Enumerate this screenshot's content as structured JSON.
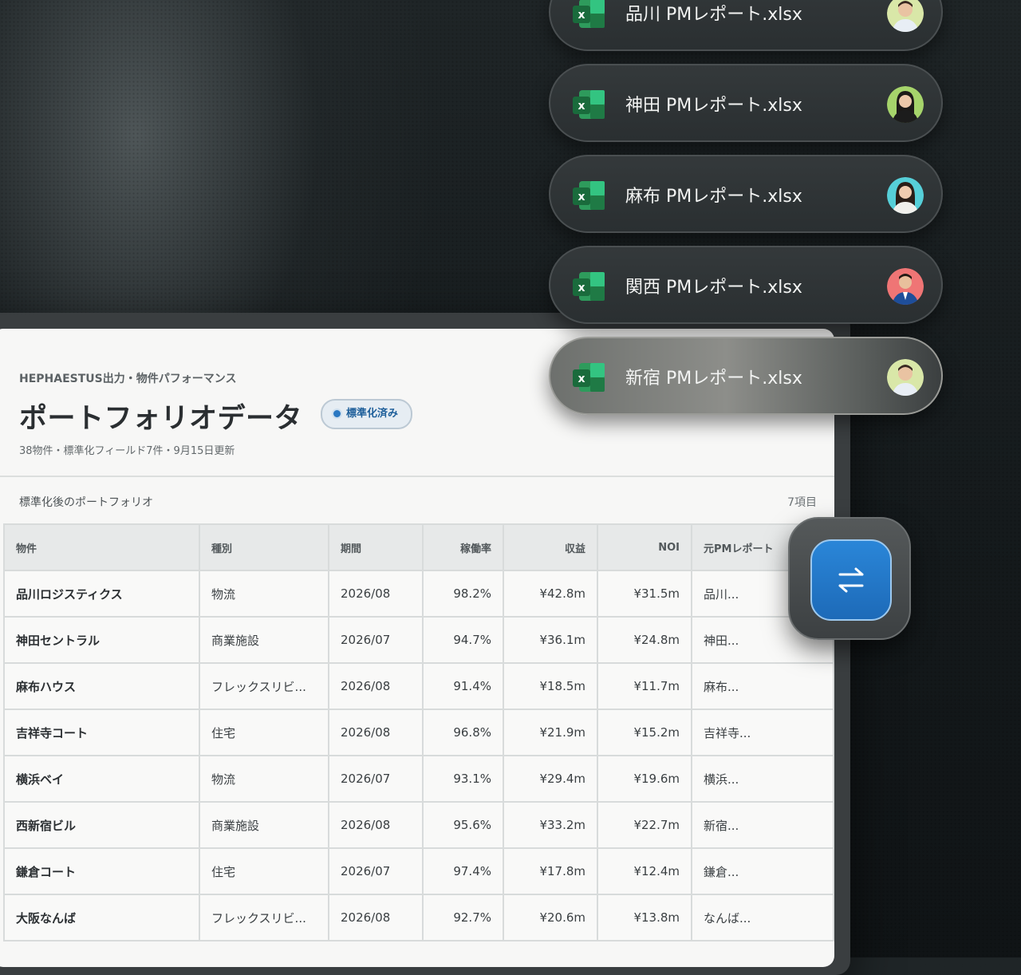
{
  "colors": {
    "excel_green": "#1f7a45",
    "accent_blue": "#2279cc",
    "panel_bg": "#f7f7f6"
  },
  "files": [
    {
      "name": "品川 PMレポート.xlsx",
      "icon": "excel-file-icon",
      "avatar": "man-light-green"
    },
    {
      "name": "神田 PMレポート.xlsx",
      "icon": "excel-file-icon",
      "avatar": "woman-green"
    },
    {
      "name": "麻布 PMレポート.xlsx",
      "icon": "excel-file-icon",
      "avatar": "woman-cyan"
    },
    {
      "name": "関西 PMレポート.xlsx",
      "icon": "excel-file-icon",
      "avatar": "man-red"
    },
    {
      "name": "新宿 PMレポート.xlsx",
      "icon": "excel-file-icon",
      "avatar": "man-light-green",
      "active": true
    }
  ],
  "panel": {
    "eyebrow": "HEPHAESTUS出力・物件パフォーマンス",
    "title": "ポートフォリオデータ",
    "badge": "標準化済み",
    "meta": "38物件・標準化フィールド7件・9月15日更新",
    "section_label": "標準化後のポートフォリオ",
    "section_count": "7項目"
  },
  "table": {
    "columns": [
      "物件",
      "種別",
      "期間",
      "稼働率",
      "収益",
      "NOI",
      "元PMレポート"
    ],
    "rows": [
      [
        "品川ロジスティクス",
        "物流",
        "2026/08",
        "98.2%",
        "¥42.8m",
        "¥31.5m",
        "品川..."
      ],
      [
        "神田セントラル",
        "商業施設",
        "2026/07",
        "94.7%",
        "¥36.1m",
        "¥24.8m",
        "神田..."
      ],
      [
        "麻布ハウス",
        "フレックスリビ...",
        "2026/08",
        "91.4%",
        "¥18.5m",
        "¥11.7m",
        "麻布..."
      ],
      [
        "吉祥寺コート",
        "住宅",
        "2026/08",
        "96.8%",
        "¥21.9m",
        "¥15.2m",
        "吉祥寺..."
      ],
      [
        "横浜ベイ",
        "物流",
        "2026/07",
        "93.1%",
        "¥29.4m",
        "¥19.6m",
        "横浜..."
      ],
      [
        "西新宿ビル",
        "商業施設",
        "2026/08",
        "95.6%",
        "¥33.2m",
        "¥22.7m",
        "新宿..."
      ],
      [
        "鎌倉コート",
        "住宅",
        "2026/07",
        "97.4%",
        "¥17.8m",
        "¥12.4m",
        "鎌倉..."
      ],
      [
        "大阪なんば",
        "フレックスリビ...",
        "2026/08",
        "92.7%",
        "¥20.6m",
        "¥13.8m",
        "なんば..."
      ]
    ]
  },
  "swap_button": {
    "icon": "swap-arrows-icon"
  }
}
